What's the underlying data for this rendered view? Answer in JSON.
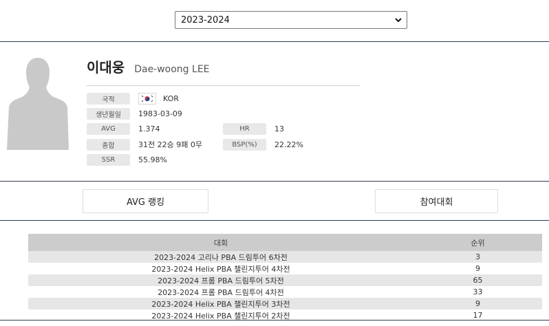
{
  "season": {
    "selected": "2023-2024"
  },
  "player": {
    "name_ko": "이대웅",
    "name_en": "Dae-woong LEE",
    "nationality": "KOR",
    "birth": "1983-03-09",
    "avg": "1.374",
    "hr": "13",
    "record": "31전 22승 9패 0무",
    "bsp": "22.22%",
    "ssr": "55.98%"
  },
  "labels": {
    "nationality": "국적",
    "birth": "생년월일",
    "avg": "AVG",
    "hr": "HR",
    "record": "종합",
    "bsp": "BSP(%)",
    "ssr": "SSR"
  },
  "tabs": {
    "avg_ranking": "AVG 랭킹",
    "tournaments": "참여대회"
  },
  "table": {
    "headers": [
      "대회",
      "순위"
    ],
    "rows": [
      {
        "event": "2023-2024 고리나 PBA 드림투어 6차전",
        "rank": "3"
      },
      {
        "event": "2023-2024 Helix PBA 챌린지투어 4차전",
        "rank": "9"
      },
      {
        "event": "2023-2024 프롬 PBA 드림투어 5차전",
        "rank": "65"
      },
      {
        "event": "2023-2024 프롬 PBA 드림투어 4차전",
        "rank": "33"
      },
      {
        "event": "2023-2024 Helix PBA 챌린지투어 3차전",
        "rank": "9"
      },
      {
        "event": "2023-2024 Helix PBA 챌린지투어 2차전",
        "rank": "17"
      }
    ]
  },
  "icons": {
    "flag": "korea-flag-icon",
    "profile": "silhouette-icon",
    "dropdown": "chevron-down-icon"
  }
}
